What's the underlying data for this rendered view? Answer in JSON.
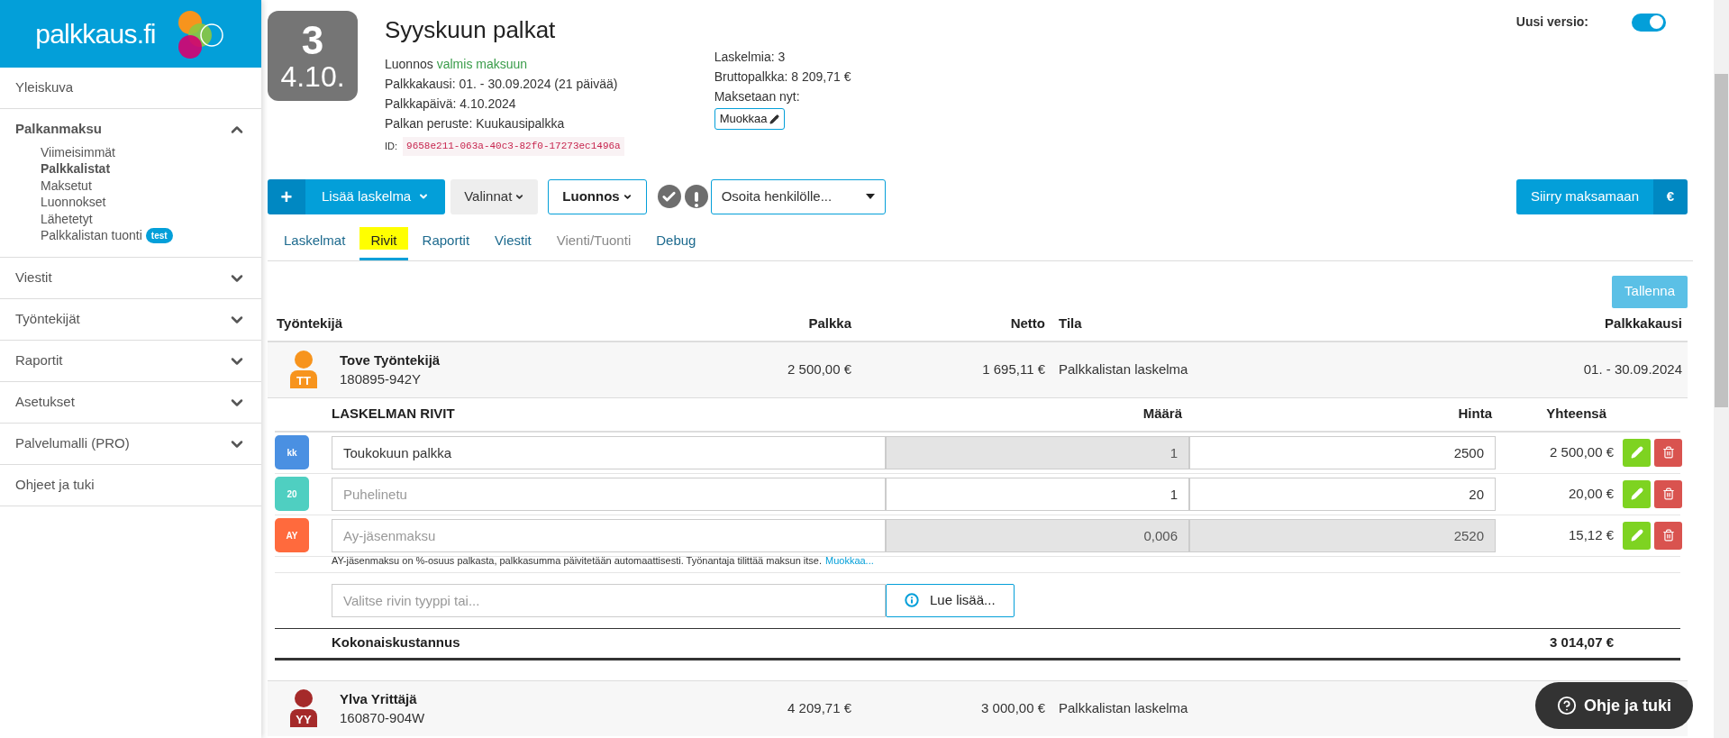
{
  "sidebar": {
    "logo_text": "palkkaus.fi",
    "items": [
      {
        "kind": "link",
        "label": "Yleiskuva"
      },
      {
        "kind": "group",
        "label": "Palkanmaksu",
        "expanded": true,
        "children": [
          {
            "label": "Viimeisimmät",
            "selected": false
          },
          {
            "label": "Palkkalistat",
            "selected": true
          },
          {
            "label": "Maksetut",
            "selected": false
          },
          {
            "label": "Luonnokset",
            "selected": false
          },
          {
            "label": "Lähetetyt",
            "selected": false
          },
          {
            "label": "Palkkalistan tuonti",
            "selected": false,
            "badge": "test"
          }
        ]
      },
      {
        "kind": "group",
        "label": "Viestit",
        "expanded": false
      },
      {
        "kind": "group",
        "label": "Työntekijät",
        "expanded": false
      },
      {
        "kind": "group",
        "label": "Raportit",
        "expanded": false
      },
      {
        "kind": "group",
        "label": "Asetukset",
        "expanded": false
      },
      {
        "kind": "group",
        "label": "Palvelumalli (PRO)",
        "expanded": false
      },
      {
        "kind": "link",
        "label": "Ohjeet ja tuki"
      }
    ]
  },
  "header": {
    "count": "3",
    "date": "4.10.",
    "title": "Syyskuun palkat",
    "status_prefix": "Luonnos",
    "status": "valmis maksuun",
    "info": [
      "Palkkakausi: 01. - 30.09.2024 (21 päivää)",
      "Palkkapäivä: 4.10.2024",
      "Palkan peruste: Kuukausipalkka"
    ],
    "id_label": "ID:",
    "id": "9658e211-063a-40c3-82f0-17273ec1496a",
    "right_info": [
      "Laskelmia: 3",
      "Bruttopalkka: 8 209,71 €",
      "Maksetaan nyt:"
    ],
    "edit_button": "Muokkaa"
  },
  "version_toggle": {
    "label": "Uusi versio:",
    "on": true
  },
  "toolbar": {
    "add_icon": "+",
    "add_button": "Lisää laskelma",
    "options_button": "Valinnat",
    "status_button": "Luonnos",
    "assign_select": "Osoita henkilölle...",
    "pay_button": "Siirry maksamaan",
    "pay_icon": "€"
  },
  "tabs": [
    {
      "label": "Laskelmat",
      "selected": false,
      "disabled": false
    },
    {
      "label": "Rivit",
      "selected": true,
      "disabled": false
    },
    {
      "label": "Raportit",
      "selected": false,
      "disabled": false
    },
    {
      "label": "Viestit",
      "selected": false,
      "disabled": false
    },
    {
      "label": "Vienti/Tuonti",
      "selected": false,
      "disabled": true
    },
    {
      "label": "Debug",
      "selected": false,
      "disabled": false
    }
  ],
  "save_button": {
    "label": "Tallenna",
    "disabled": true
  },
  "table": {
    "columns": [
      "Työntekijä",
      "Palkka",
      "Netto",
      "Tila",
      "Palkkakausi"
    ],
    "employees": [
      {
        "name": "Tove Työntekijä",
        "id": "180895-942Y",
        "initials": "TT",
        "color": "#f7941d",
        "salary": "2 500,00 €",
        "net": "1 695,11 €",
        "state": "Palkkalistan laskelma",
        "period": "01. - 30.09.2024",
        "expanded": true
      },
      {
        "name": "Ylva Yrittäjä",
        "id": "160870-904W",
        "initials": "YY",
        "color": "#a52a2a",
        "salary": "4 209,71 €",
        "net": "3 000,00 €",
        "state": "Palkkalistan laskelma",
        "expanded": false
      }
    ]
  },
  "rows_section": {
    "title": "LASKELMAN RIVIT",
    "columns": [
      "Määrä",
      "Hinta",
      "Yhteensä"
    ],
    "rows": [
      {
        "code": "kk",
        "color": "#4a90e2",
        "value": "Toukokuun palkka",
        "quantity": "1",
        "quantity_locked": true,
        "price": "2500",
        "price_locked": false,
        "total": "2 500,00 €"
      },
      {
        "code": "20",
        "color": "#4fcfc1",
        "placeholder": "Puhelinetu",
        "quantity": "1",
        "quantity_locked": false,
        "price": "20",
        "price_locked": false,
        "total": "20,00 €"
      },
      {
        "code": "AY",
        "color": "#ff6a3d",
        "placeholder": "Ay-jäsenmaksu",
        "quantity": "0,006",
        "quantity_locked": true,
        "price": "2520",
        "price_locked": true,
        "total": "15,12 €"
      }
    ],
    "note": "AY-jäsenmaksu on %-osuus palkasta, palkkasumma päivitetään automaattisesti. Työnantaja tilittää maksun itse.",
    "note_link": "Muokkaa...",
    "add_placeholder": "Valitse rivin tyyppi tai...",
    "info_button": "Lue lisää...",
    "total_label": "Kokonaiskustannus",
    "total": "3 014,07 €"
  },
  "help_button": "Ohje ja tuki"
}
